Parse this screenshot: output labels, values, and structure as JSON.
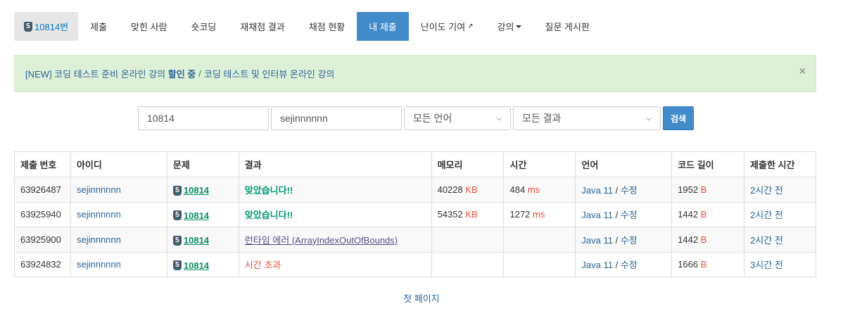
{
  "tabs": {
    "problem_badge": "5",
    "problem_label": "10814번",
    "submit": "제출",
    "solvers": "맞힌 사람",
    "shortcoding": "숏코딩",
    "rejudge_result": "재채점 결과",
    "judge_status": "채점 현황",
    "my_submissions": "내 제출",
    "difficulty": "난이도 기여",
    "lecture": "강의",
    "qna": "질문 게시판"
  },
  "alert": {
    "prefix": "[NEW] 코딩 테스트 준비 온라인 강의",
    "bold": "할인 중",
    "sep": "/",
    "link2": "코딩 테스트 및 인터뷰 온라인 강의",
    "close": "×"
  },
  "search": {
    "problem_id": "10814",
    "user_id": "sejinnnnnn",
    "language": "모든 언어",
    "result": "모든 결과",
    "button": "검색"
  },
  "table": {
    "headers": [
      "제출 번호",
      "아이디",
      "문제",
      "결과",
      "메모리",
      "시간",
      "언어",
      "코드 길이",
      "제출한 시간"
    ],
    "rows": [
      {
        "id": "63926487",
        "user": "sejinnnnnn",
        "tier": "5",
        "problem": "10814",
        "result": "맞았습니다!!",
        "memory": "40228",
        "memory_unit": "KB",
        "time": "484",
        "time_unit": "ms",
        "lang": "Java 11",
        "slash": "/",
        "edit": "수정",
        "length": "1952",
        "length_unit": "B",
        "when": "2시간 전"
      },
      {
        "id": "63925940",
        "user": "sejinnnnnn",
        "tier": "5",
        "problem": "10814",
        "result": "맞았습니다!!",
        "memory": "54352",
        "memory_unit": "KB",
        "time": "1272",
        "time_unit": "ms",
        "lang": "Java 11",
        "slash": "/",
        "edit": "수정",
        "length": "1442",
        "length_unit": "B",
        "when": "2시간 전"
      },
      {
        "id": "63925900",
        "user": "sejinnnnnn",
        "tier": "5",
        "problem": "10814",
        "result": "런타임 에러 (ArrayIndexOutOfBounds)",
        "lang": "Java 11",
        "slash": "/",
        "edit": "수정",
        "length": "1442",
        "length_unit": "B",
        "when": "2시간 전"
      },
      {
        "id": "63924832",
        "user": "sejinnnnnn",
        "tier": "5",
        "problem": "10814",
        "result": "시간 초과",
        "lang": "Java 11",
        "slash": "/",
        "edit": "수정",
        "length": "1666",
        "length_unit": "B",
        "when": "3시간 전"
      }
    ]
  },
  "pager": {
    "first_page": "첫 페이지"
  },
  "colors": {
    "accent": "#428bca",
    "alert_bg": "#dff0d8",
    "accepted": "#009874",
    "error": "#e74c3c",
    "link": "#2a6496"
  }
}
